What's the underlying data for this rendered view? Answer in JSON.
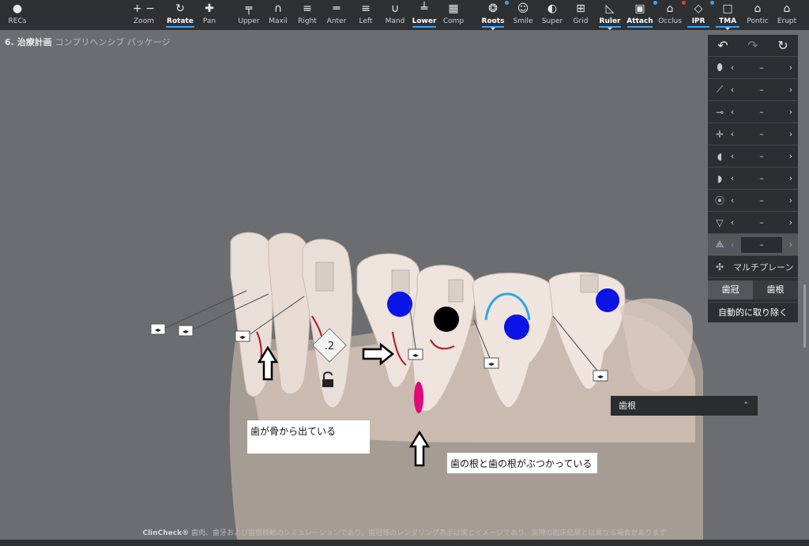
{
  "toolbar": {
    "items": [
      {
        "label": "RECs",
        "icon": "●"
      },
      {
        "label": "Zoom",
        "icon": "+ −"
      },
      {
        "label": "Rotate",
        "icon": "↻"
      },
      {
        "label": "Pan",
        "icon": "✚"
      },
      {
        "label": "Upper",
        "icon": "╤"
      },
      {
        "label": "Maxil",
        "icon": "∩"
      },
      {
        "label": "Right",
        "icon": "≡"
      },
      {
        "label": "Anter",
        "icon": "═"
      },
      {
        "label": "Left",
        "icon": "≡"
      },
      {
        "label": "Mand",
        "icon": "∪"
      },
      {
        "label": "Lower",
        "icon": "╧"
      },
      {
        "label": "Comp",
        "icon": "▦"
      },
      {
        "label": "Roots",
        "icon": "❂"
      },
      {
        "label": "Smile",
        "icon": "☺"
      },
      {
        "label": "Super",
        "icon": "◐"
      },
      {
        "label": "Grid",
        "icon": "⊞"
      },
      {
        "label": "Ruler",
        "icon": "◺"
      },
      {
        "label": "Attach",
        "icon": "▣"
      },
      {
        "label": "Occlus",
        "icon": "⌂"
      },
      {
        "label": "IPR",
        "icon": "◇"
      },
      {
        "label": "TMA",
        "icon": "□"
      },
      {
        "label": "Pontic",
        "icon": "⌂"
      },
      {
        "label": "Erupt",
        "icon": "⌂"
      }
    ]
  },
  "title": {
    "main": "6. 治療計画",
    "sub": "コンプリヘンシブ パッケージ"
  },
  "panel": {
    "rows": [
      {
        "value": "–"
      },
      {
        "value": "–"
      },
      {
        "value": "–"
      },
      {
        "value": "–"
      },
      {
        "value": "–"
      },
      {
        "value": "–"
      },
      {
        "value": "–"
      },
      {
        "value": "–"
      },
      {
        "value": "–"
      }
    ],
    "multiplane": "マルチプレーン",
    "seg_crown": "歯冠",
    "seg_root": "歯根",
    "auto_remove": "自動的に取り除く"
  },
  "dropdown": {
    "label": "歯根"
  },
  "scene": {
    "ipr_value": ".2"
  },
  "notes": {
    "note1": "歯が骨から出ている",
    "note2": "歯の根と歯の根がぶつかっている"
  },
  "footer": {
    "brand": "ClinCheck®",
    "text": " 歯肉、歯牙および歯根移動のシミュレーションであり、歯冠等のレンダリング表示は実とイメージであり、実際の臨床結果とは異なる場合があります"
  },
  "colors": {
    "accent": "#33a6ff",
    "marker_blue": "#0a14e6",
    "marker_black": "#000000",
    "root_mark": "#e0087a"
  }
}
